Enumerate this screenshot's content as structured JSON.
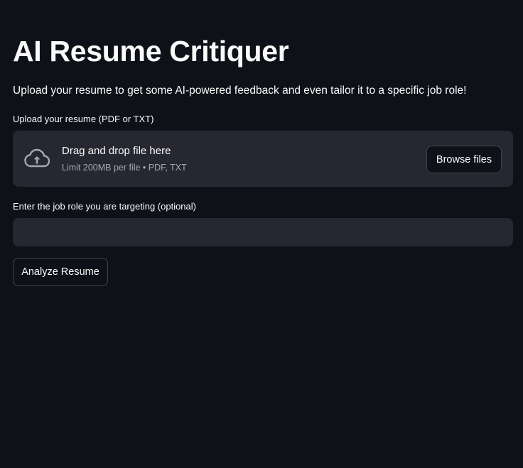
{
  "page": {
    "title": "AI Resume Critiquer",
    "intro": "Upload your resume to get some AI-powered feedback and even tailor it to a specific job role!"
  },
  "uploader": {
    "label": "Upload your resume (PDF or TXT)",
    "dropzone_title": "Drag and drop file here",
    "dropzone_limits": "Limit 200MB per file • PDF, TXT",
    "browse_label": "Browse files",
    "icon": "cloud-upload-icon"
  },
  "job_role": {
    "label": "Enter the job role you are targeting (optional)",
    "value": "",
    "placeholder": ""
  },
  "actions": {
    "analyze_label": "Analyze Resume"
  },
  "colors": {
    "background": "#0e1117",
    "surface": "#262730",
    "text": "#fafafa",
    "muted_text": "#a3a8b8"
  }
}
